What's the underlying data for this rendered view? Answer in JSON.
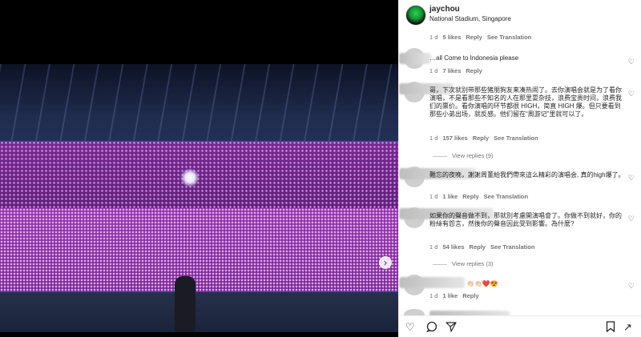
{
  "post": {
    "username": "jaychou",
    "location": "National Stadium, Singapore"
  },
  "comments": [
    {
      "time": "1 d",
      "likes": "5 likes",
      "reply": "Reply",
      "translate": "See Translation",
      "text": ""
    },
    {
      "time": "1 d",
      "likes": "7 likes",
      "reply": "Reply",
      "translate": "",
      "text": "…all Come to Indonesia please"
    },
    {
      "time": "1 d",
      "likes": "157 likes",
      "reply": "Reply",
      "translate": "See Translation",
      "text": "哥，下次就别带那些猪朋狗友来凑热闹了。去你演唱会就是为了看你演唱，不是看那些不知名的人在那里耍杂技，浪费宝贵时间，浪费我们的票价。看你演唱的环节都很 HIGH，简直 HIGH 爆。但只要看到那些小弟出场，就反感。他们留在“周游记”里就可以了。",
      "view_replies": "View replies (9)"
    },
    {
      "time": "1 d",
      "likes": "1 like",
      "reply": "Reply",
      "translate": "See Translation",
      "text": "難忘的夜晚，謝謝周董給我們帶來這么精彩的演唱会, 真的high爆了。"
    },
    {
      "time": "1 d",
      "likes": "54 likes",
      "reply": "Reply",
      "translate": "See Translation",
      "text": "如果你的聲音做不到，那就別考慮開演唱會了。你做不到就好，你的粉絲有怨言，然後你的聲音因此受到影響。為什麼?",
      "view_replies": "View replies (3)"
    },
    {
      "time": "1 d",
      "likes": "1 like",
      "reply": "Reply",
      "translate": "",
      "text": "👏🏻👏🏻❤️😍"
    }
  ],
  "icons": {
    "more": "more-icon",
    "heart": "heart-icon",
    "comment": "comment-icon",
    "share": "share-icon",
    "bookmark": "bookmark-icon",
    "next": "next-arrow-icon"
  }
}
